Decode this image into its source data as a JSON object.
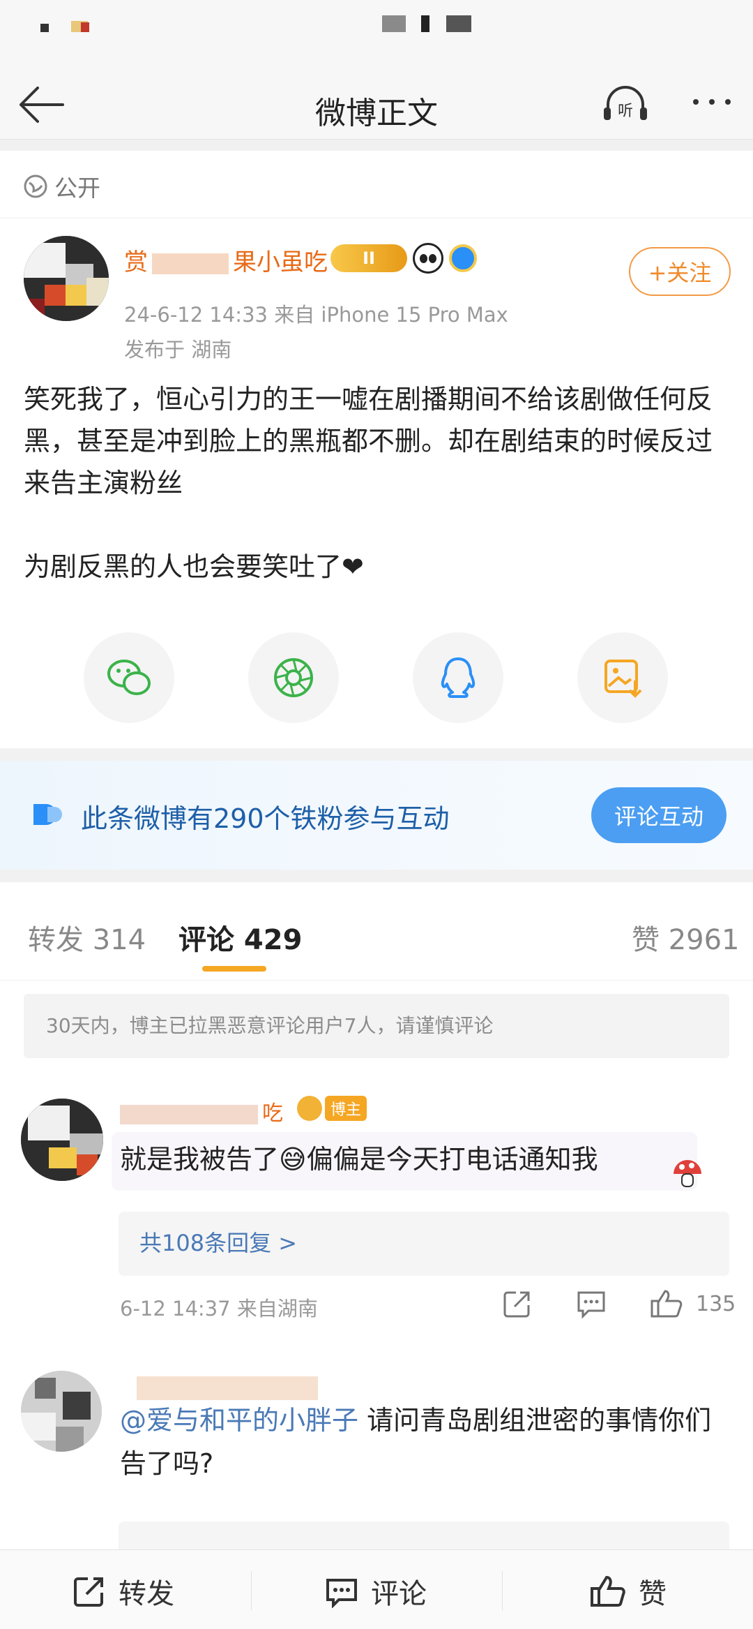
{
  "nav": {
    "title": "微博正文",
    "back_icon": "arrow-left-icon",
    "listen_label": "听",
    "more_icon": "more-dots-icon"
  },
  "post": {
    "visibility": "公开",
    "author_name_visible_parts": [
      "赏",
      "果小虽吃"
    ],
    "level_badge": "II",
    "meta": "24-6-12 14:33   来自 iPhone 15 Pro Max",
    "location": "发布于 湖南",
    "follow_label": "+关注",
    "text_lines": [
      "笑死我了，恒心引力的王一嘘在剧播期间不给该剧做任何反黑，甚至是冲到脸上的黑瓶都不删。却在剧结束的时候反过来告主演粉丝",
      "为剧反黑的人也会要笑吐了❤"
    ],
    "share_icons": [
      "wechat-icon",
      "moments-icon",
      "qq-icon",
      "save-image-icon"
    ]
  },
  "fan_banner": {
    "text": "此条微博有290个铁粉参与互动",
    "button": "评论互动"
  },
  "tabs": {
    "repost": "转发 314",
    "comment": "评论 429",
    "like": "赞 2961"
  },
  "notice": "30天内，博主已拉黑恶意评论用户7人，请谨慎评论",
  "comments": [
    {
      "name_visible": "吃",
      "tag": "博主",
      "text": "就是我被告了😅偏偏是今天打电话通知我",
      "replies": "共108条回复 >",
      "meta": "6-12 14:37  来自湖南",
      "likes": "135"
    },
    {
      "mention": "@爱与和平的小胖子",
      "text": " 请问青岛剧组泄密的事情你们告了吗?"
    }
  ],
  "bottom_bar": {
    "repost": "转发",
    "comment": "评论",
    "like": "赞"
  },
  "colors": {
    "accent_orange": "#f08a2c",
    "link_blue": "#4a79b6",
    "button_blue": "#4b9ef2"
  }
}
